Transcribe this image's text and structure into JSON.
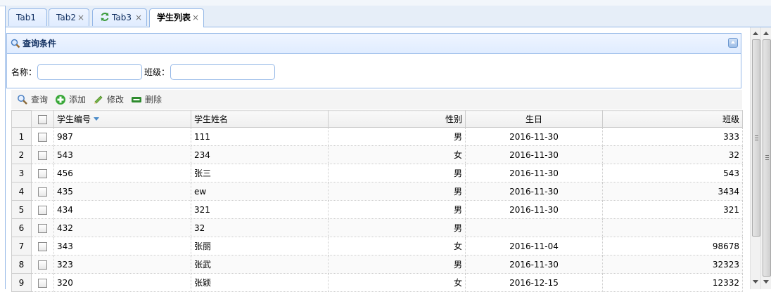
{
  "tabs": [
    {
      "label": "Tab1",
      "closable": false
    },
    {
      "label": "Tab2",
      "closable": true
    },
    {
      "label": "Tab3",
      "closable": true,
      "icon": "refresh-icon"
    },
    {
      "label": "学生列表",
      "closable": true,
      "active": true
    }
  ],
  "close_glyph": "×",
  "query_panel": {
    "title": "查询条件",
    "fields": [
      {
        "label": "名称：",
        "value": ""
      },
      {
        "label": "班级：",
        "value": ""
      }
    ]
  },
  "toolbar": {
    "search_label": "查询",
    "add_label": "添加",
    "edit_label": "修改",
    "delete_label": "删除"
  },
  "table": {
    "columns": [
      "学生编号",
      "学生姓名",
      "性别",
      "生日",
      "班级"
    ],
    "sorted_column": "学生编号",
    "rows": [
      {
        "n": "1",
        "id": "987",
        "name": "111",
        "gender": "男",
        "birthday": "2016-11-30",
        "class": "333"
      },
      {
        "n": "2",
        "id": "543",
        "name": "234",
        "gender": "女",
        "birthday": "2016-11-30",
        "class": "32"
      },
      {
        "n": "3",
        "id": "456",
        "name": "张三",
        "gender": "男",
        "birthday": "2016-11-30",
        "class": "543"
      },
      {
        "n": "4",
        "id": "435",
        "name": "ew",
        "gender": "男",
        "birthday": "2016-11-30",
        "class": "3434"
      },
      {
        "n": "5",
        "id": "434",
        "name": "321",
        "gender": "男",
        "birthday": "2016-11-30",
        "class": "321"
      },
      {
        "n": "6",
        "id": "432",
        "name": "32",
        "gender": "男",
        "birthday": "",
        "class": ""
      },
      {
        "n": "7",
        "id": "343",
        "name": "张丽",
        "gender": "女",
        "birthday": "2016-11-04",
        "class": "98678"
      },
      {
        "n": "8",
        "id": "323",
        "name": "张武",
        "gender": "男",
        "birthday": "2016-11-30",
        "class": "32323"
      },
      {
        "n": "9",
        "id": "320",
        "name": "张颖",
        "gender": "女",
        "birthday": "2016-12-15",
        "class": "12332"
      }
    ]
  },
  "colors": {
    "border": "#95b8e7",
    "header_bg": "#e0ecff",
    "title_text": "#0e2d5f"
  }
}
